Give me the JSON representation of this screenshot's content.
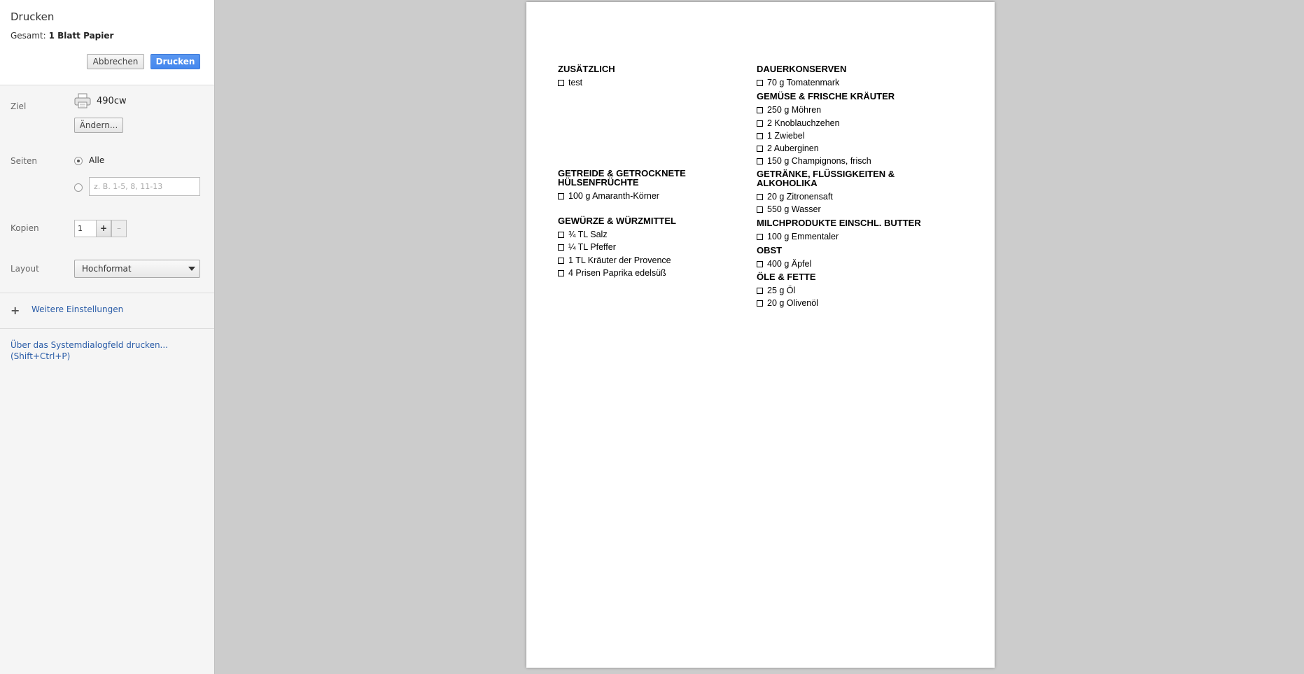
{
  "dialog": {
    "title": "Drucken",
    "total_prefix": "Gesamt:",
    "total_value": "1 Blatt Papier",
    "cancel_label": "Abbrechen",
    "print_label": "Drucken"
  },
  "destination": {
    "label": "Ziel",
    "printer_name": "490cw",
    "change_label": "Ändern..."
  },
  "pages": {
    "label": "Seiten",
    "all_label": "Alle",
    "range_placeholder": "z. B. 1-5, 8, 11-13"
  },
  "copies": {
    "label": "Kopien",
    "value": "1",
    "plus": "+",
    "minus": "–"
  },
  "layout": {
    "label": "Layout",
    "selected": "Hochformat"
  },
  "more_settings_label": "Weitere Einstellungen",
  "system_dialog": {
    "line1": "Über das Systemdialogfeld drucken...",
    "line2": "(Shift+Ctrl+P)"
  },
  "preview": {
    "left_column": [
      {
        "title": "ZUSÄTZLICH",
        "items": [
          "test"
        ]
      },
      {
        "title": "GETREIDE & GETROCKNETE HÜLSENFRÜCHTE",
        "items": [
          "100 g Amaranth-Körner"
        ]
      },
      {
        "title": "GEWÜRZE & WÜRZMITTEL",
        "items": [
          "¾ TL Salz",
          "¼ TL Pfeffer",
          "1 TL Kräuter der Provence",
          "4 Prisen Paprika edelsüß"
        ]
      }
    ],
    "right_column": [
      {
        "title": "DAUERKONSERVEN",
        "items": [
          "70 g Tomatenmark"
        ]
      },
      {
        "title": "GEMÜSE & FRISCHE KRÄUTER",
        "items": [
          "250 g Möhren",
          "2 Knoblauchzehen",
          "1 Zwiebel",
          "2 Auberginen",
          "150 g Champignons, frisch"
        ]
      },
      {
        "title": "GETRÄNKE, FLÜSSIGKEITEN & ALKOHOLIKA",
        "items": [
          "20 g Zitronensaft",
          "550 g Wasser"
        ]
      },
      {
        "title": "MILCHPRODUKTE EINSCHL. BUTTER",
        "items": [
          "100 g Emmentaler"
        ]
      },
      {
        "title": "OBST",
        "items": [
          "400 g Äpfel"
        ]
      },
      {
        "title": "ÖLE & FETTE",
        "items": [
          "25 g Öl",
          "20 g Olivenöl"
        ]
      }
    ]
  }
}
